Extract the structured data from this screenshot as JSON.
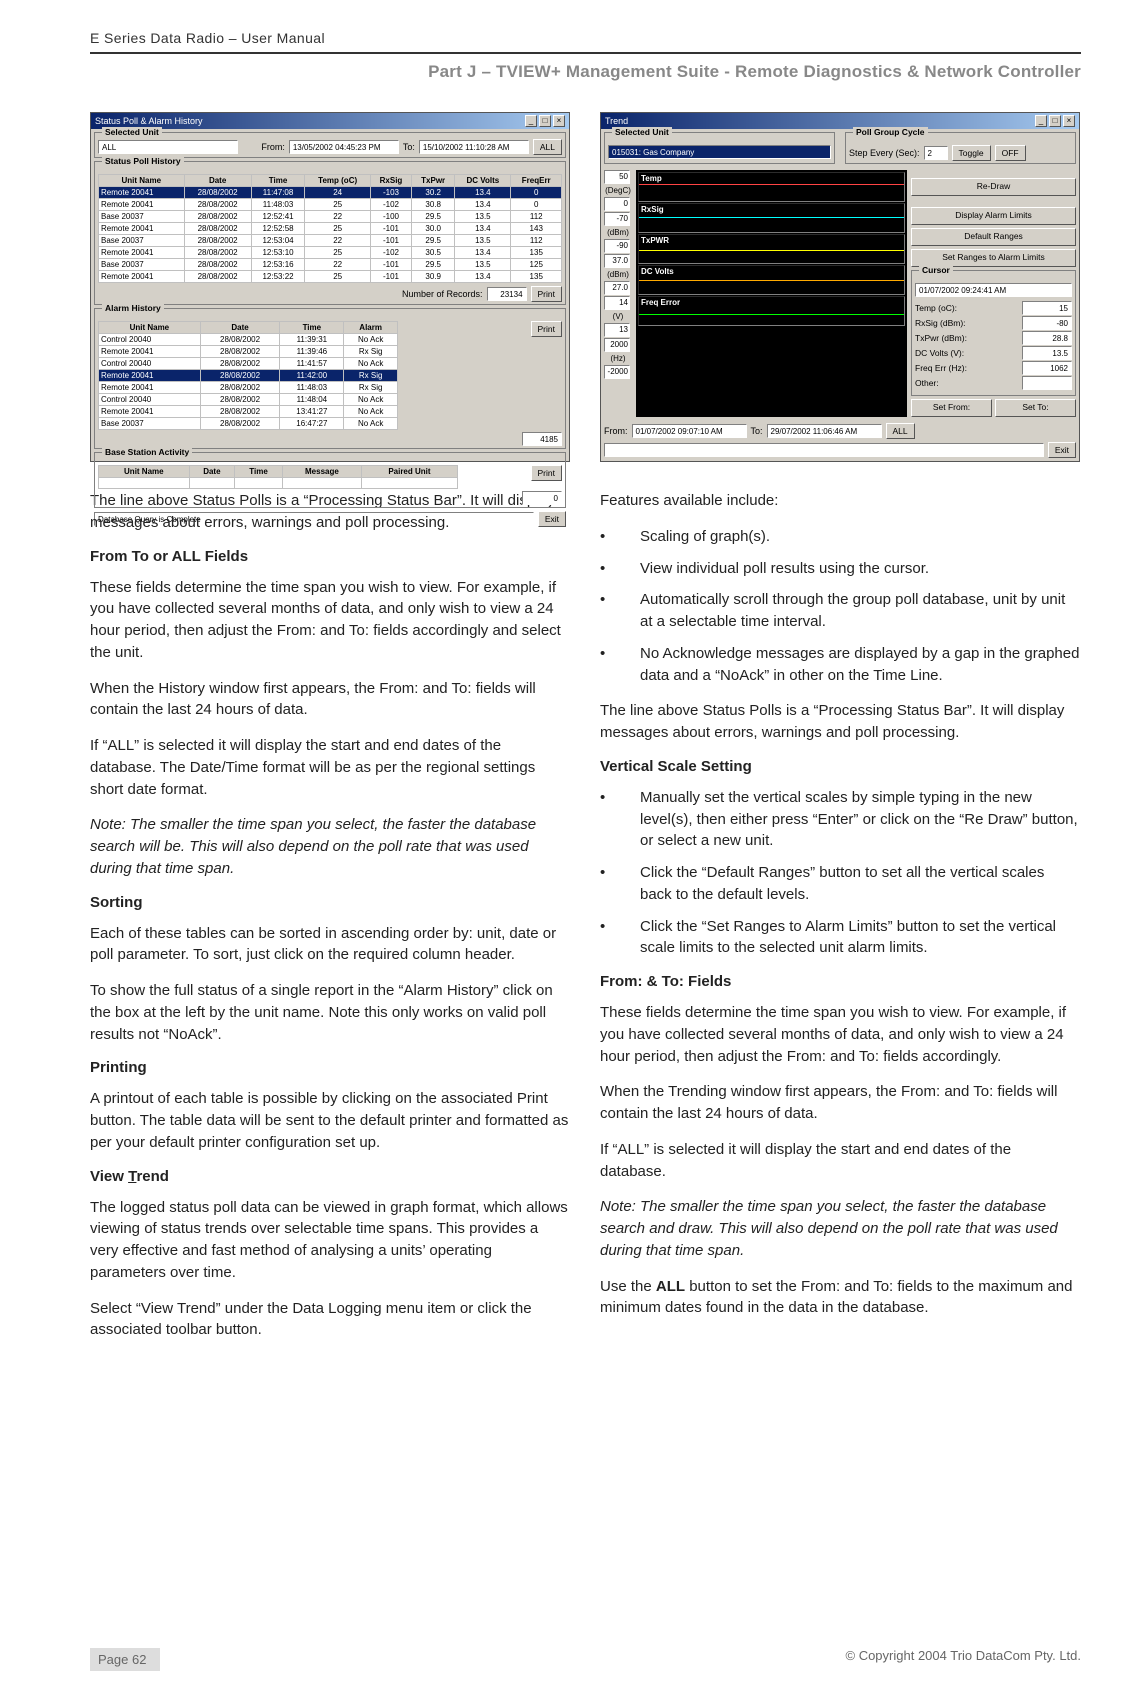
{
  "header": {
    "product": "E Series Data Radio – User Manual",
    "part": "Part J – TVIEW+ Management Suite -  Remote Diagnostics & Network Controller"
  },
  "win1": {
    "title": "Status Poll & Alarm History",
    "selected_unit_legend": "Selected Unit",
    "selected_unit": "ALL",
    "from_label": "From:",
    "from": "13/05/2002 04:45:23 PM",
    "to_label": "To:",
    "to": "15/10/2002 11:10:28 AM",
    "all": "ALL",
    "sph_legend": "Status Poll History",
    "sph_headers": [
      "Unit Name",
      "Date",
      "Time",
      "Temp (oC)",
      "RxSig",
      "TxPwr",
      "DC Volts",
      "FreqErr"
    ],
    "sph_rows": [
      [
        "Remote 20041",
        "28/08/2002",
        "11:47:08",
        "24",
        "-103",
        "30.2",
        "13.4",
        "0"
      ],
      [
        "Remote 20041",
        "28/08/2002",
        "11:48:03",
        "25",
        "-102",
        "30.8",
        "13.4",
        "0"
      ],
      [
        "Base 20037",
        "28/08/2002",
        "12:52:41",
        "22",
        "-100",
        "29.5",
        "13.5",
        "112"
      ],
      [
        "Remote 20041",
        "28/08/2002",
        "12:52:58",
        "25",
        "-101",
        "30.0",
        "13.4",
        "143"
      ],
      [
        "Base 20037",
        "28/08/2002",
        "12:53:04",
        "22",
        "-101",
        "29.5",
        "13.5",
        "112"
      ],
      [
        "Remote 20041",
        "28/08/2002",
        "12:53:10",
        "25",
        "-102",
        "30.5",
        "13.4",
        "135"
      ],
      [
        "Base 20037",
        "28/08/2002",
        "12:53:16",
        "22",
        "-101",
        "29.5",
        "13.5",
        "125"
      ],
      [
        "Remote 20041",
        "28/08/2002",
        "12:53:22",
        "25",
        "-101",
        "30.9",
        "13.4",
        "135"
      ]
    ],
    "numrec_label": "Number of Records:",
    "numrec": "23134",
    "print": "Print",
    "ah_legend": "Alarm History",
    "ah_headers": [
      "Unit Name",
      "Date",
      "Time",
      "Alarm"
    ],
    "ah_rows": [
      [
        "Control 20040",
        "28/08/2002",
        "11:39:31",
        "No Ack"
      ],
      [
        "Remote 20041",
        "28/08/2002",
        "11:39:46",
        "Rx Sig"
      ],
      [
        "Control 20040",
        "28/08/2002",
        "11:41:57",
        "No Ack"
      ],
      [
        "Remote 20041",
        "28/08/2002",
        "11:42:00",
        "Rx Sig"
      ],
      [
        "Remote 20041",
        "28/08/2002",
        "11:48:03",
        "Rx Sig"
      ],
      [
        "Control 20040",
        "28/08/2002",
        "11:48:04",
        "No Ack"
      ],
      [
        "Remote 20041",
        "28/08/2002",
        "13:41:27",
        "No Ack"
      ],
      [
        "Base 20037",
        "28/08/2002",
        "16:47:27",
        "No Ack"
      ]
    ],
    "ah_count": "4185",
    "bsa_legend": "Base Station Activity",
    "bsa_headers": [
      "Unit Name",
      "Date",
      "Time",
      "Message",
      "Paired Unit"
    ],
    "bsa_count": "0",
    "status": "Database Query is Complete",
    "exit": "Exit"
  },
  "win2": {
    "title": "Trend",
    "selected_unit_legend": "Selected Unit",
    "selected_unit": "015031: Gas Company",
    "pgc_legend": "Poll Group Cycle",
    "step_label": "Step Every (Sec):",
    "step": "2",
    "toggle": "Toggle",
    "off": "OFF",
    "charts": [
      {
        "name": "Temp",
        "unit": "(DegC)",
        "top": "50",
        "bot": "0",
        "wave": "wave-red"
      },
      {
        "name": "RxSig",
        "unit": "(dBm)",
        "top": "-70",
        "bot": "-90",
        "wave": "wave-cyan"
      },
      {
        "name": "TxPWR",
        "unit": "(dBm)",
        "top": "37.0",
        "bot": "27.0",
        "wave": "wave-yellow"
      },
      {
        "name": "DC Volts",
        "unit": "(V)",
        "top": "14",
        "bot": "13",
        "wave": "wave-orange"
      },
      {
        "name": "Freq Error",
        "unit": "(Hz)",
        "top": "2000",
        "bot": "-2000",
        "wave": "wave-green"
      }
    ],
    "redraw": "Re-Draw",
    "display_alarm": "Display Alarm Limits",
    "default_ranges": "Default Ranges",
    "set_ranges": "Set Ranges to Alarm Limits",
    "cursor_legend": "Cursor",
    "cursor_time": "01/07/2002 09:24:41 AM",
    "kv": [
      {
        "label": "Temp (oC):",
        "val": "15"
      },
      {
        "label": "RxSig (dBm):",
        "val": "-80"
      },
      {
        "label": "TxPwr (dBm):",
        "val": "28.8"
      },
      {
        "label": "DC Volts (V):",
        "val": "13.5"
      },
      {
        "label": "Freq Err (Hz):",
        "val": "1062"
      },
      {
        "label": "Other:",
        "val": ""
      }
    ],
    "from_label": "From:",
    "from": "01/07/2002 09:07:10 AM",
    "to_label": "To:",
    "to": "29/07/2002 11:06:46 AM",
    "all": "ALL",
    "set_from": "Set From:",
    "set_to": "Set To:",
    "exit": "Exit"
  },
  "leftText": {
    "p1": "The line above Status Polls is a “Processing Status Bar”.  It will display messages about errors, warnings and poll processing.",
    "h1": "From To or ALL Fields",
    "p2": "These fields determine the time span you wish to view.  For example, if you have collected several months of data, and only wish to view a 24 hour period, then adjust the From: and To: fields accordingly and select the unit.",
    "p3": "When the History window first appears, the From: and To: fields will contain the last 24 hours of data.",
    "p4": "If “ALL” is selected it will display the start and end dates of the database. The Date/Time format will be as per the regional settings short date format.",
    "p5": "Note: The smaller the time span you select, the faster the database search will be.  This will also depend on the poll rate that was used during that time span.",
    "h2": "Sorting",
    "p6": "Each of these tables can be sorted in ascending order by: unit, date or poll parameter.  To sort, just click on the required column header.",
    "p7": "To show the full status of a single report in the “Alarm History” click on the box at the left by the unit name. Note this only works on valid poll results not “NoAck”.",
    "h3": "Printing",
    "p8": "A printout of each table is possible by clicking on the associated Print button.  The table data will be sent to the default printer and formatted as per your default printer configuration set up.",
    "h4_pre": "View ",
    "h4_u": "T",
    "h4_post": "rend",
    "p9": "The logged status poll data can be viewed in graph format, which allows viewing of status trends over selectable time spans.  This provides a very effective and fast method of analysing a units’ operating parameters over time.",
    "p10": "Select “View Trend” under the Data Logging menu item or click the associated toolbar button."
  },
  "rightText": {
    "p1": "Features available include:",
    "li1": "Scaling of graph(s).",
    "li2": "View individual poll results using the cursor.",
    "li3": "Automatically scroll through the group poll database, unit by unit at a selectable time interval.",
    "li4": "No Acknowledge messages are displayed by a gap in the graphed data and a “NoAck” in other on the Time Line.",
    "p2": "The line above Status Polls is a “Processing Status Bar”.  It will display messages about errors, warnings and poll processing.",
    "h1": "Vertical Scale Setting",
    "li5": "Manually set the vertical scales by simple typing in the new level(s), then either press “Enter” or click on the “Re Draw” button, or select a new unit.",
    "li6": "Click the “Default Ranges” button to set all the vertical scales back to the default levels.",
    "li7": "Click the “Set Ranges to Alarm Limits” button to set the vertical scale limits to the selected unit alarm limits.",
    "h2": "From: & To: Fields",
    "p3": "These fields determine the time span you wish to view.  For example, if you have collected several months of data, and only wish to view a 24 hour period, then adjust the From: and To: fields accordingly.",
    "p4": "When the Trending window first appears, the From: and To: fields will contain the last 24 hours of data.",
    "p5": "If “ALL” is selected it will display the start and end dates of the database.",
    "p6": "Note:  The smaller the time span you select, the faster the database search and draw. This will also depend on the poll rate that was used during that time span.",
    "p7a": "Use the ",
    "p7b": "ALL",
    "p7c": " button to set the From: and To: fields to the maximum and minimum dates found in the data in the database."
  },
  "footer": {
    "page": "Page 62",
    "copyright": "© Copyright 2004 Trio DataCom Pty. Ltd."
  }
}
